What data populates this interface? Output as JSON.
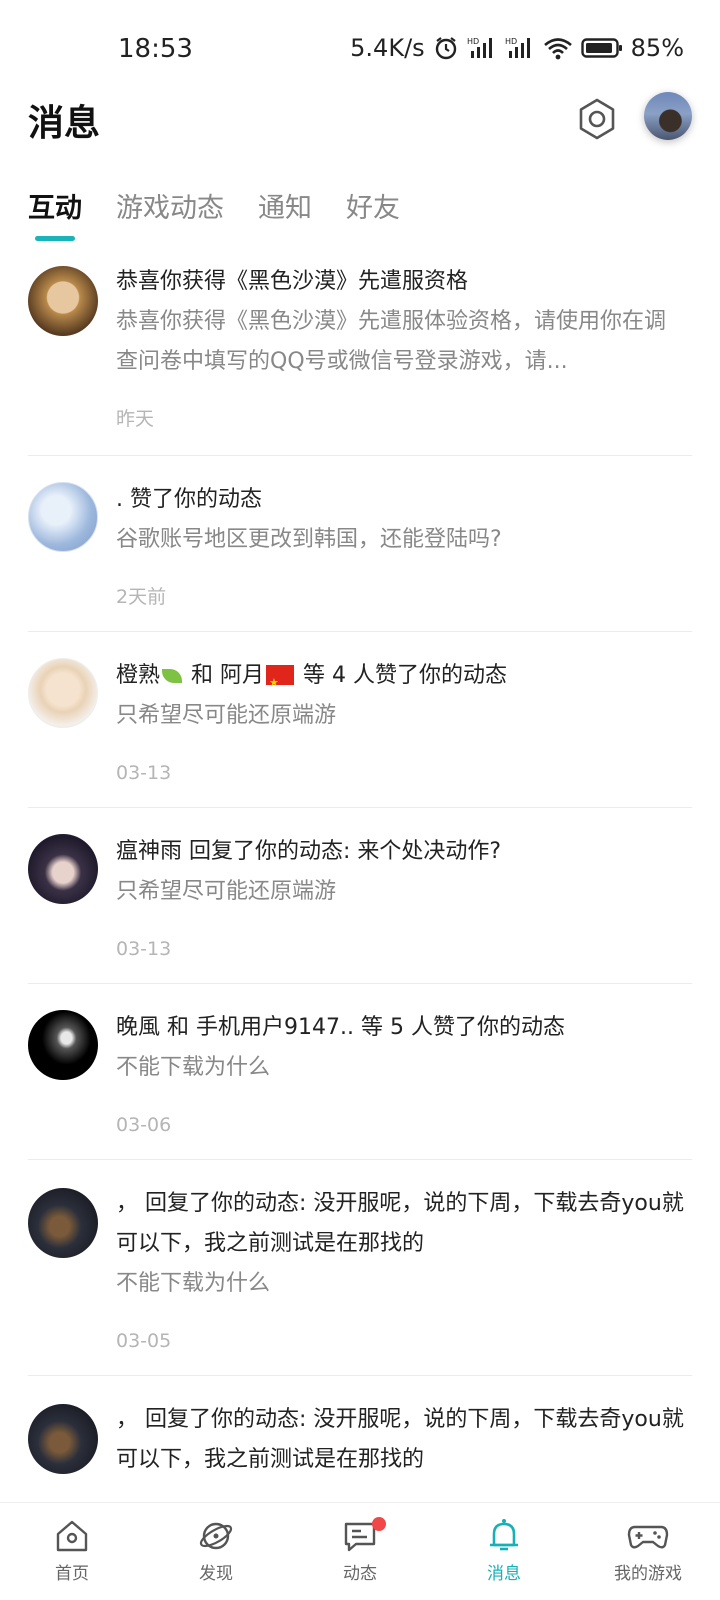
{
  "status_bar": {
    "time": "18:53",
    "network_speed": "5.4K/s",
    "battery": "85%",
    "icons": [
      "alarm-icon",
      "signal-hd-icon",
      "signal-hd-icon",
      "wifi-icon",
      "battery-icon"
    ]
  },
  "header": {
    "title": "消息",
    "settings_icon": "gear-icon"
  },
  "tabs": [
    {
      "label": "互动",
      "active": true
    },
    {
      "label": "游戏动态",
      "active": false
    },
    {
      "label": "通知",
      "active": false
    },
    {
      "label": "好友",
      "active": false
    }
  ],
  "messages": [
    {
      "title": "恭喜你获得《黑色沙漠》先遣服资格",
      "desc": "恭喜你获得《黑色沙漠》先遣服体验资格，请使用你在调查问卷中填写的QQ号或微信号登录游戏，请...",
      "time": "昨天"
    },
    {
      "title": ". 赞了你的动态",
      "desc": "谷歌账号地区更改到韩国，还能登陆吗?",
      "time": "2天前"
    },
    {
      "title_part1": "橙熟",
      "title_part2": " 和 阿月",
      "title_part3": " 等 4 人赞了你的动态",
      "desc": "只希望尽可能还原端游",
      "time": "03-13"
    },
    {
      "title": "瘟神雨 回复了你的动态: 来个处决动作?",
      "desc": "只希望尽可能还原端游",
      "time": "03-13"
    },
    {
      "title": "晚風 和 手机用户9147.. 等 5 人赞了你的动态",
      "desc": "不能下载为什么",
      "time": "03-06"
    },
    {
      "title": "，  回复了你的动态: 没开服呢，说的下周，下载去奇you就可以下，我之前测试是在那找的",
      "desc": "不能下载为什么",
      "time": "03-05"
    },
    {
      "title": "，  回复了你的动态: 没开服呢，说的下周，下载去奇you就可以下，我之前测试是在那找的",
      "desc": "",
      "time": ""
    }
  ],
  "bottom_nav": [
    {
      "label": "首页",
      "icon": "home-icon",
      "active": false
    },
    {
      "label": "发现",
      "icon": "discover-icon",
      "active": false
    },
    {
      "label": "动态",
      "icon": "feed-icon",
      "active": false,
      "badge": true
    },
    {
      "label": "消息",
      "icon": "bell-icon",
      "active": true
    },
    {
      "label": "我的游戏",
      "icon": "gamepad-icon",
      "active": false
    }
  ],
  "colors": {
    "accent": "#17b0b6",
    "badge": "#f04848"
  }
}
